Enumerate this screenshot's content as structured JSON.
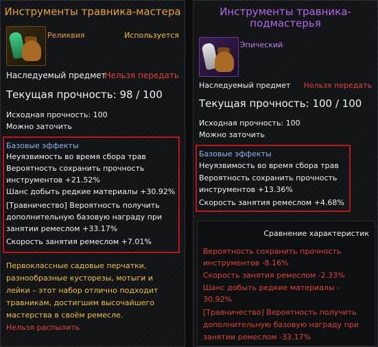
{
  "left": {
    "title": "Инструменты травника-мастера",
    "rarity": "Реликвия",
    "status": "Используется",
    "inherited": "Наследуемый предмет",
    "no_transfer": "Нельзя передать",
    "durability": "Текущая прочность: 98 / 100",
    "base_durability": "Исходная прочность: 100",
    "sharpen": "Можно заточить",
    "effects_title": "Базовые эффекты",
    "effects": [
      "Неуязвимость во время сбора трав",
      "Вероятность сохранить прочность",
      "инструментов +21.52%",
      "Шанс добыть редкие материалы +30.92%",
      "[Травничество] Вероятность получить",
      "дополнительную базовую награду при",
      "занятии ремеслом +33.17%",
      "Скорость занятия ремеслом +7.01%"
    ],
    "description": [
      "Первоклассные садовые перчатки,",
      "разнообразные кусторезы, мотыги и",
      "лейки – этот набор отлично подходит",
      "травникам, достигшим высочайшего",
      "мастерства в своём ремесле."
    ],
    "no_disenchant": "Нельзя распылить"
  },
  "right": {
    "title_line1": "Инструменты травника-",
    "title_line2": "подмастерья",
    "rarity": "Эпический",
    "inherited": "Наследуемый предмет",
    "no_transfer": "Нельзя передать",
    "durability": "Текущая прочность: 100 / 100",
    "base_durability": "Исходная прочность: 100",
    "sharpen": "Можно заточить",
    "effects_title": "Базовые эффекты",
    "effects": [
      "Неуязвимость во время сбора трав",
      "Вероятность сохранить прочность",
      "инструментов +13.36%",
      "Скорость занятия ремеслом +4.68%"
    ],
    "compare_title": "Сравнение характеристик",
    "compare": [
      "Вероятность сохранить прочность",
      "инструментов -8.16%",
      "Скорость занятия ремеслом -2.33%",
      "Шанс добыть редкие материалы -",
      "30.92%",
      "[Травничество] Вероятность получить",
      "дополнительную базовую награду при",
      "занятии ремеслом -33.17%"
    ]
  },
  "colors": {
    "legendary_title": "#e7a33a",
    "epic_title": "#b469e8",
    "warning_red": "#e0433b",
    "highlight_box": "#c0141a",
    "effects_blue": "#8fb4e6"
  },
  "icons": [
    "herbalist-tools-legendary-icon",
    "herbalist-tools-epic-icon"
  ]
}
